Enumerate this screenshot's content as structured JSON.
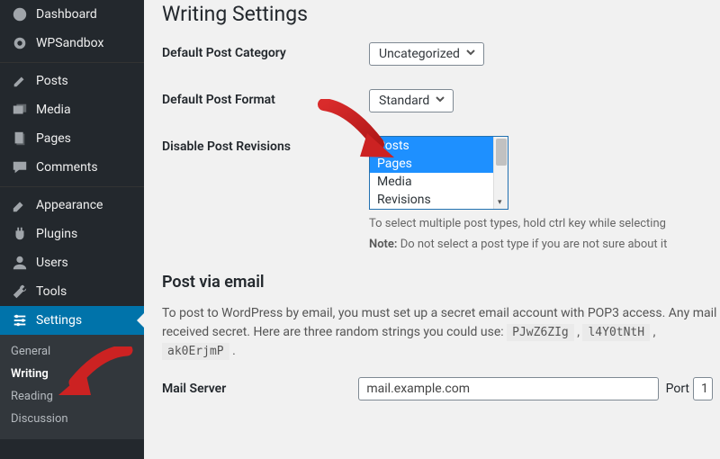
{
  "sidebar": {
    "items": [
      {
        "label": "Dashboard",
        "icon": "dashboard-icon"
      },
      {
        "label": "WPSandbox",
        "icon": "sandbox-icon"
      },
      {
        "label": "Posts",
        "icon": "posts-icon"
      },
      {
        "label": "Media",
        "icon": "media-icon"
      },
      {
        "label": "Pages",
        "icon": "pages-icon"
      },
      {
        "label": "Comments",
        "icon": "comments-icon"
      },
      {
        "label": "Appearance",
        "icon": "appearance-icon"
      },
      {
        "label": "Plugins",
        "icon": "plugins-icon"
      },
      {
        "label": "Users",
        "icon": "users-icon"
      },
      {
        "label": "Tools",
        "icon": "tools-icon"
      },
      {
        "label": "Settings",
        "icon": "settings-icon"
      }
    ],
    "submenu": [
      {
        "label": "General"
      },
      {
        "label": "Writing"
      },
      {
        "label": "Reading"
      },
      {
        "label": "Discussion"
      }
    ]
  },
  "page": {
    "title": "Writing Settings",
    "default_category_label": "Default Post Category",
    "default_category_value": "Uncategorized",
    "default_format_label": "Default Post Format",
    "default_format_value": "Standard",
    "disable_revisions_label": "Disable Post Revisions",
    "disable_revisions_options": [
      "Posts",
      "Pages",
      "Media",
      "Revisions"
    ],
    "disable_revisions_help1": "To select multiple post types, hold ctrl key while selecting",
    "disable_revisions_note_label": "Note:",
    "disable_revisions_note": " Do not select a post type if you are not sure about it",
    "email_heading": "Post via email",
    "email_desc_pre": "To post to WordPress by email, you must set up a secret email account with POP3 access. Any mail received secret. Here are three random strings you could use: ",
    "email_codes": [
      "PJwZ6ZIg",
      "l4Y0tNtH",
      "ak0ErjmP"
    ],
    "email_desc_post": " .",
    "mail_server_label": "Mail Server",
    "mail_server_value": "mail.example.com",
    "port_label": "Port",
    "port_value": "1"
  }
}
